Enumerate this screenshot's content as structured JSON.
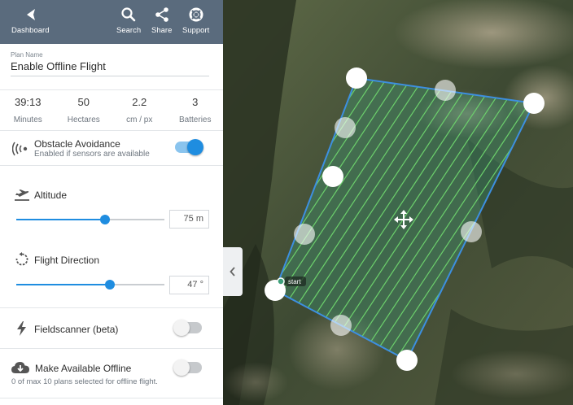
{
  "topbar": {
    "dashboard": "Dashboard",
    "search": "Search",
    "share": "Share",
    "support": "Support"
  },
  "plan": {
    "caption": "Plan Name",
    "value": "Enable Offline Flight"
  },
  "stats": [
    {
      "value": "39:13",
      "unit": "Minutes"
    },
    {
      "value": "50",
      "unit": "Hectares"
    },
    {
      "value": "2.2",
      "unit": "cm / px"
    },
    {
      "value": "3",
      "unit": "Batteries"
    }
  ],
  "obstacle": {
    "title": "Obstacle Avoidance",
    "subtitle": "Enabled if sensors are available",
    "enabled": true
  },
  "altitude": {
    "title": "Altitude",
    "value": "75 m",
    "slider_fraction": 0.6
  },
  "direction": {
    "title": "Flight Direction",
    "value": "47 °",
    "slider_fraction": 0.63
  },
  "fieldscanner": {
    "title": "Fieldscanner (beta)",
    "enabled": false
  },
  "offline": {
    "title": "Make Available Offline",
    "subtitle": "0 of max 10 plans selected for offline flight.",
    "enabled": false
  },
  "map": {
    "start_label": "start"
  },
  "colors": {
    "topbar": "#5a6b7d",
    "accent": "#1f8de0",
    "polygon_edge": "#3d8fe0",
    "hatch": "#6cd06c"
  }
}
